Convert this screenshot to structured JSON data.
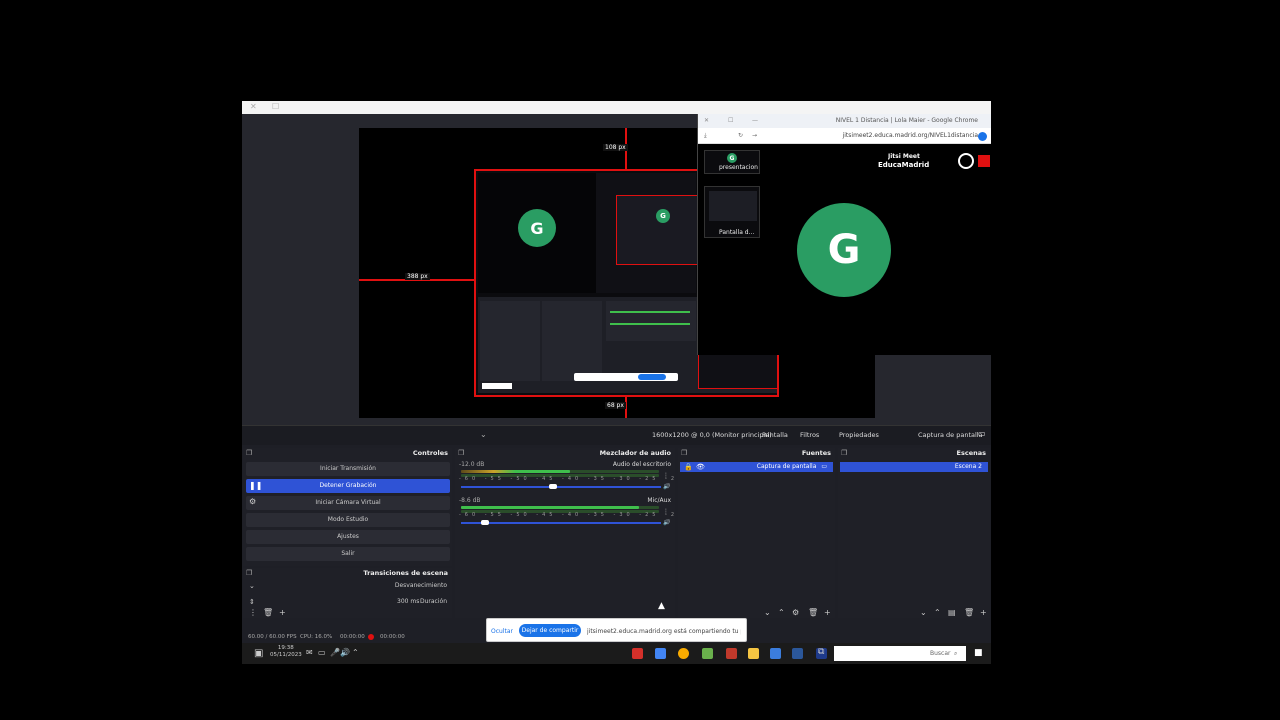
{
  "chrome_window": {
    "tab_title": "NIVEL 1 Distancia | Lola Maier - Google Chrome",
    "address": "jitsimeet2.educa.madrid.org/NIVEL1distancia",
    "brand_line1": "Jitsi Meet",
    "brand_line2": "EducaMadrid",
    "avatar_letter": "G",
    "thumb1_label": "presentacion",
    "thumb2_label": "Pantalla d..."
  },
  "preview": {
    "guide_top": "108 px",
    "guide_left": "388 px",
    "guide_bottom": "68 px",
    "avatar_letter": "G"
  },
  "context_bar": {
    "source_name": "Captura de pantalla",
    "properties": "Propiedades",
    "filters": "Filtros",
    "display_label": "Pantalla",
    "display_value": "1600x1200 @ 0,0 (Monitor principal)"
  },
  "scenes": {
    "title": "Escenas",
    "items": [
      "Escena 2"
    ]
  },
  "sources": {
    "title": "Fuentes",
    "items": [
      "Captura de pantalla"
    ]
  },
  "mixer": {
    "title": "Mezclador de audio",
    "channels": [
      {
        "name": "Audio del escritorio",
        "db": "-12.0 dB",
        "level": 0.55
      },
      {
        "name": "Mic/Aux",
        "db": "-8.6 dB",
        "level": 0.9
      }
    ],
    "ticks": "-60 -55 -50 -45 -40 -35 -30 -25 -20 -15 -10 -5 0"
  },
  "controls": {
    "title": "Controles",
    "buttons": [
      "Iniciar Transmisión",
      "Detener Grabación",
      "Iniciar Cámara Virtual",
      "Modo Estudio",
      "Ajustes",
      "Salir"
    ]
  },
  "transitions": {
    "title": "Transiciones de escena",
    "type": "Desvanecimiento",
    "duration_label": "Duración",
    "duration_value": "300 ms"
  },
  "status": {
    "rec": "00:00:00",
    "time": "00:00:00",
    "cpu": "CPU: 16.0%",
    "fps": "60.00 / 60.00 FPS"
  },
  "share_toast": {
    "message": "jitsimeet2.educa.madrid.org está compartiendo tu pantalla",
    "stop_button": "Dejar de compartir",
    "hide_link": "Ocultar"
  },
  "taskbar": {
    "search_placeholder": "Buscar",
    "clock_time": "19:38",
    "clock_date": "05/11/2023"
  },
  "colors": {
    "accent": "#2f53d6",
    "guide": "#e01010",
    "avatar": "#2a9d63"
  }
}
